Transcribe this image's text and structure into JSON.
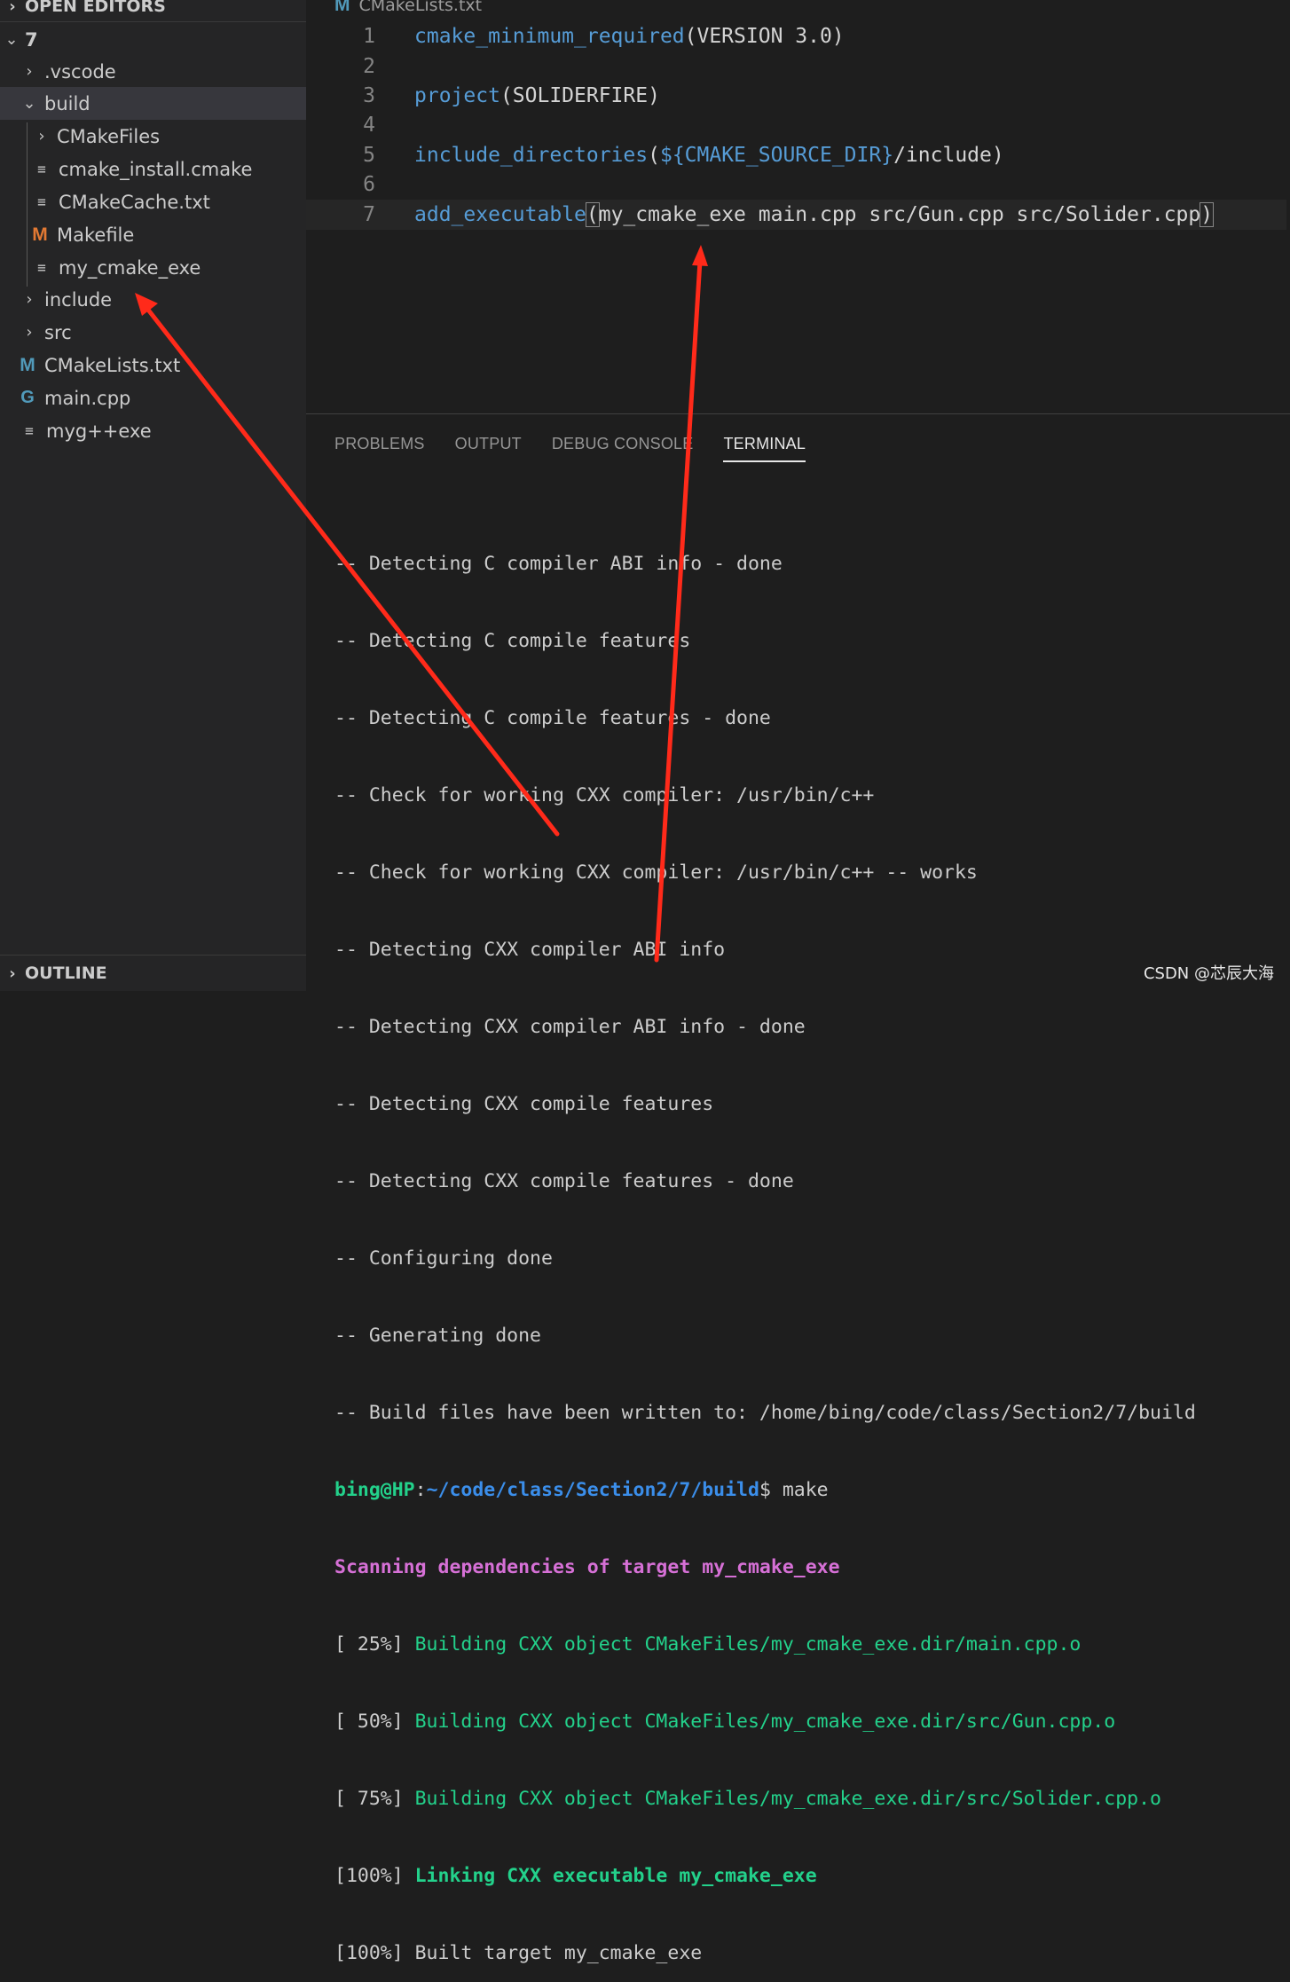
{
  "sidebar": {
    "open_editors_label": "OPEN EDITORS",
    "outline_label": "OUTLINE",
    "tree": [
      {
        "label": "7",
        "icon": "chevron-down-icon"
      },
      {
        "label": ".vscode",
        "icon": "chevron-right-icon"
      },
      {
        "label": "build",
        "icon": "chevron-down-icon"
      },
      {
        "label": "CMakeFiles",
        "icon": "chevron-right-icon"
      },
      {
        "label": "cmake_install.cmake",
        "icon": "file-lines-icon"
      },
      {
        "label": "CMakeCache.txt",
        "icon": "file-lines-icon"
      },
      {
        "label": "Makefile",
        "icon": "makefile-m-icon"
      },
      {
        "label": "my_cmake_exe",
        "icon": "file-lines-icon"
      },
      {
        "label": "include",
        "icon": "chevron-right-icon"
      },
      {
        "label": "src",
        "icon": "chevron-right-icon"
      },
      {
        "label": "CMakeLists.txt",
        "icon": "cmake-m-icon"
      },
      {
        "label": "main.cpp",
        "icon": "cpp-icon"
      },
      {
        "label": "myg++exe",
        "icon": "file-lines-icon"
      }
    ]
  },
  "editor": {
    "tab_label": "CMakeLists.txt",
    "lines": [
      {
        "n": "1",
        "fn": "cmake_minimum_required",
        "rest": "(VERSION 3.0)"
      },
      {
        "n": "2"
      },
      {
        "n": "3",
        "fn": "project",
        "rest": "(SOLIDERFIRE)"
      },
      {
        "n": "4"
      },
      {
        "n": "5",
        "fn": "include_directories",
        "open": "(",
        "var": "${CMAKE_SOURCE_DIR}",
        "rest": "/include)"
      },
      {
        "n": "6"
      },
      {
        "n": "7",
        "fn": "add_executable",
        "open": "(",
        "args": "my_cmake_exe main.cpp src/Gun.cpp src/Solider.cpp",
        "close": ")"
      }
    ]
  },
  "panel": {
    "tabs": [
      "PROBLEMS",
      "OUTPUT",
      "DEBUG CONSOLE",
      "TERMINAL"
    ],
    "active_tab": "TERMINAL"
  },
  "terminal": {
    "plain_lines": [
      "-- Detecting C compiler ABI info - done",
      "-- Detecting C compile features",
      "-- Detecting C compile features - done",
      "-- Check for working CXX compiler: /usr/bin/c++",
      "-- Check for working CXX compiler: /usr/bin/c++ -- works",
      "-- Detecting CXX compiler ABI info",
      "-- Detecting CXX compiler ABI info - done",
      "-- Detecting CXX compile features",
      "-- Detecting CXX compile features - done",
      "-- Configuring done",
      "-- Generating done",
      "-- Build files have been written to: /home/bing/code/class/Section2/7/build"
    ],
    "prompt_user": "bing@HP",
    "prompt_sep": ":",
    "prompt_path": "~/code/class/Section2/7/build",
    "prompt_cmd": "$ make",
    "scanning": "Scanning dependencies of target my_cmake_exe",
    "build_steps": [
      {
        "pct": "[ 25%] ",
        "text": "Building CXX object CMakeFiles/my_cmake_exe.dir/main.cpp.o"
      },
      {
        "pct": "[ 50%] ",
        "text": "Building CXX object CMakeFiles/my_cmake_exe.dir/src/Gun.cpp.o"
      },
      {
        "pct": "[ 75%] ",
        "text": "Building CXX object CMakeFiles/my_cmake_exe.dir/src/Solider.cpp.o"
      }
    ],
    "link_pct": "[100%] ",
    "link_text": "Linking CXX executable my_cmake_exe",
    "built_line": "[100%] Built target my_cmake_exe"
  },
  "watermark": "CSDN @芯辰大海",
  "colors": {
    "annotation_arrow": "#ff2a1a"
  }
}
